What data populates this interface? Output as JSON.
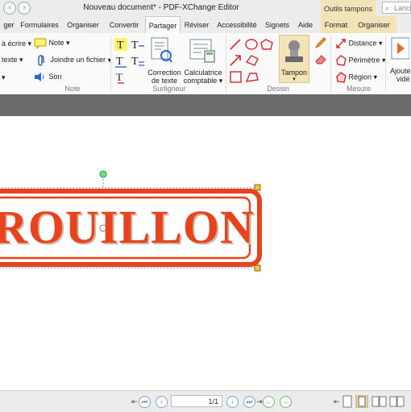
{
  "titlebar": {
    "title": "Nouveau document* - PDF-XChange Editor",
    "contextual_header": "Outils tampons",
    "search_placeholder": "Lance"
  },
  "tabs": [
    {
      "label": "ger"
    },
    {
      "label": "Formulaires"
    },
    {
      "label": "Organiser"
    },
    {
      "label": "Convertir"
    },
    {
      "label": "Partager"
    },
    {
      "label": "Réviser"
    },
    {
      "label": "Accessibilité"
    },
    {
      "label": "Signets"
    },
    {
      "label": "Aide"
    },
    {
      "label": "Format"
    },
    {
      "label": "Organiser"
    }
  ],
  "ribbon": {
    "note_group": {
      "label": "Note",
      "items": [
        "à écrire",
        "texte",
        "Note",
        "Joindre un fichier",
        "Son"
      ]
    },
    "highlight_group": {
      "label": "Surligneur",
      "correction": [
        "Correction",
        "de texte"
      ],
      "calculator": [
        "Calculatrice",
        "comptable"
      ]
    },
    "drawing_group": {
      "label": "Dessin",
      "stamp_label": "Tampon"
    },
    "measure_group": {
      "label": "Mesure",
      "items": [
        "Distance",
        "Périmètre",
        "Région"
      ]
    },
    "add_video": [
      "Ajoute",
      "vidé"
    ]
  },
  "document": {
    "stamp_text": "ROUILLON"
  },
  "status": {
    "page": "1/1"
  },
  "colors": {
    "stamp": "#e8421f",
    "accent_tab": "#f2e3b8",
    "selection_handle": "#f2c14e"
  }
}
